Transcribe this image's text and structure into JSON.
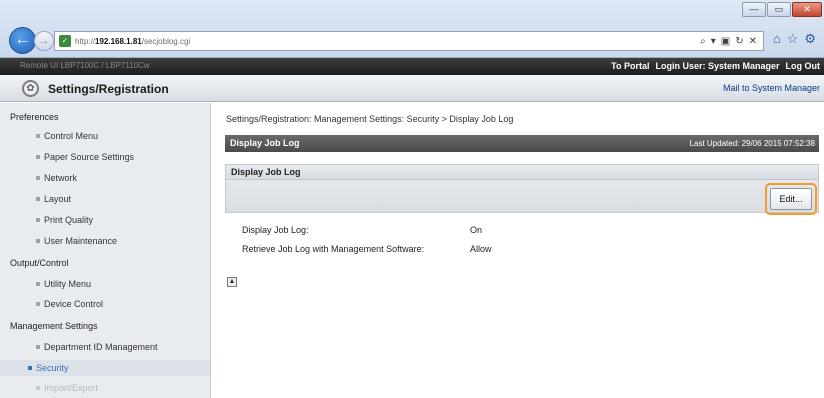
{
  "browser": {
    "window_controls": {
      "minimize": "—",
      "maximize": "▭",
      "close": "✕"
    },
    "back_glyph": "←",
    "forward_glyph": "→",
    "address": {
      "prefix": "http://",
      "host": "192.168.1.81",
      "path": "/secjoblog.cgi"
    },
    "address_actions": [
      "⌕",
      "▾",
      "▣",
      "↻",
      "✕"
    ],
    "toolbar_icons": [
      "⌂",
      "☆",
      "⚙"
    ]
  },
  "app_header": {
    "model": "Remote UI   LBP7100C / LBP7110Cw",
    "portal_link": "To Portal",
    "login_user": "Login User: System Manager",
    "logout_link": "Log Out"
  },
  "title_bar": {
    "heading": "Settings/Registration",
    "mail_link": "Mail to System Manager"
  },
  "sidebar": {
    "sections": {
      "preferences": "Preferences",
      "output_control": "Output/Control",
      "management": "Management Settings"
    },
    "items": {
      "control_menu": "Control Menu",
      "paper_source": "Paper Source Settings",
      "network": "Network",
      "layout": "Layout",
      "print_quality": "Print Quality",
      "user_maintenance": "User Maintenance",
      "utility_menu": "Utility Menu",
      "device_control": "Device Control",
      "department_id": "Department ID Management",
      "security": "Security",
      "import_export": "Import/Export"
    }
  },
  "main": {
    "breadcrumb": "Settings/Registration: Management Settings: Security > Display Job Log",
    "page_title": "Display Job Log",
    "last_updated": "Last Updated: 29/06 2015 07:52:38",
    "section_title": "Display Job Log",
    "edit_button": "Edit...",
    "fields": {
      "display_job_log": {
        "label": "Display Job Log:",
        "value": "On"
      },
      "retrieve_job_log": {
        "label": "Retrieve Job Log with Management Software:",
        "value": "Allow"
      }
    },
    "top_icon": "▲"
  },
  "colors": {
    "accent": "#f29a2e",
    "header_dark": "#2a2a2a",
    "link": "#0b3a8c",
    "selected": "#3a6fb8"
  }
}
